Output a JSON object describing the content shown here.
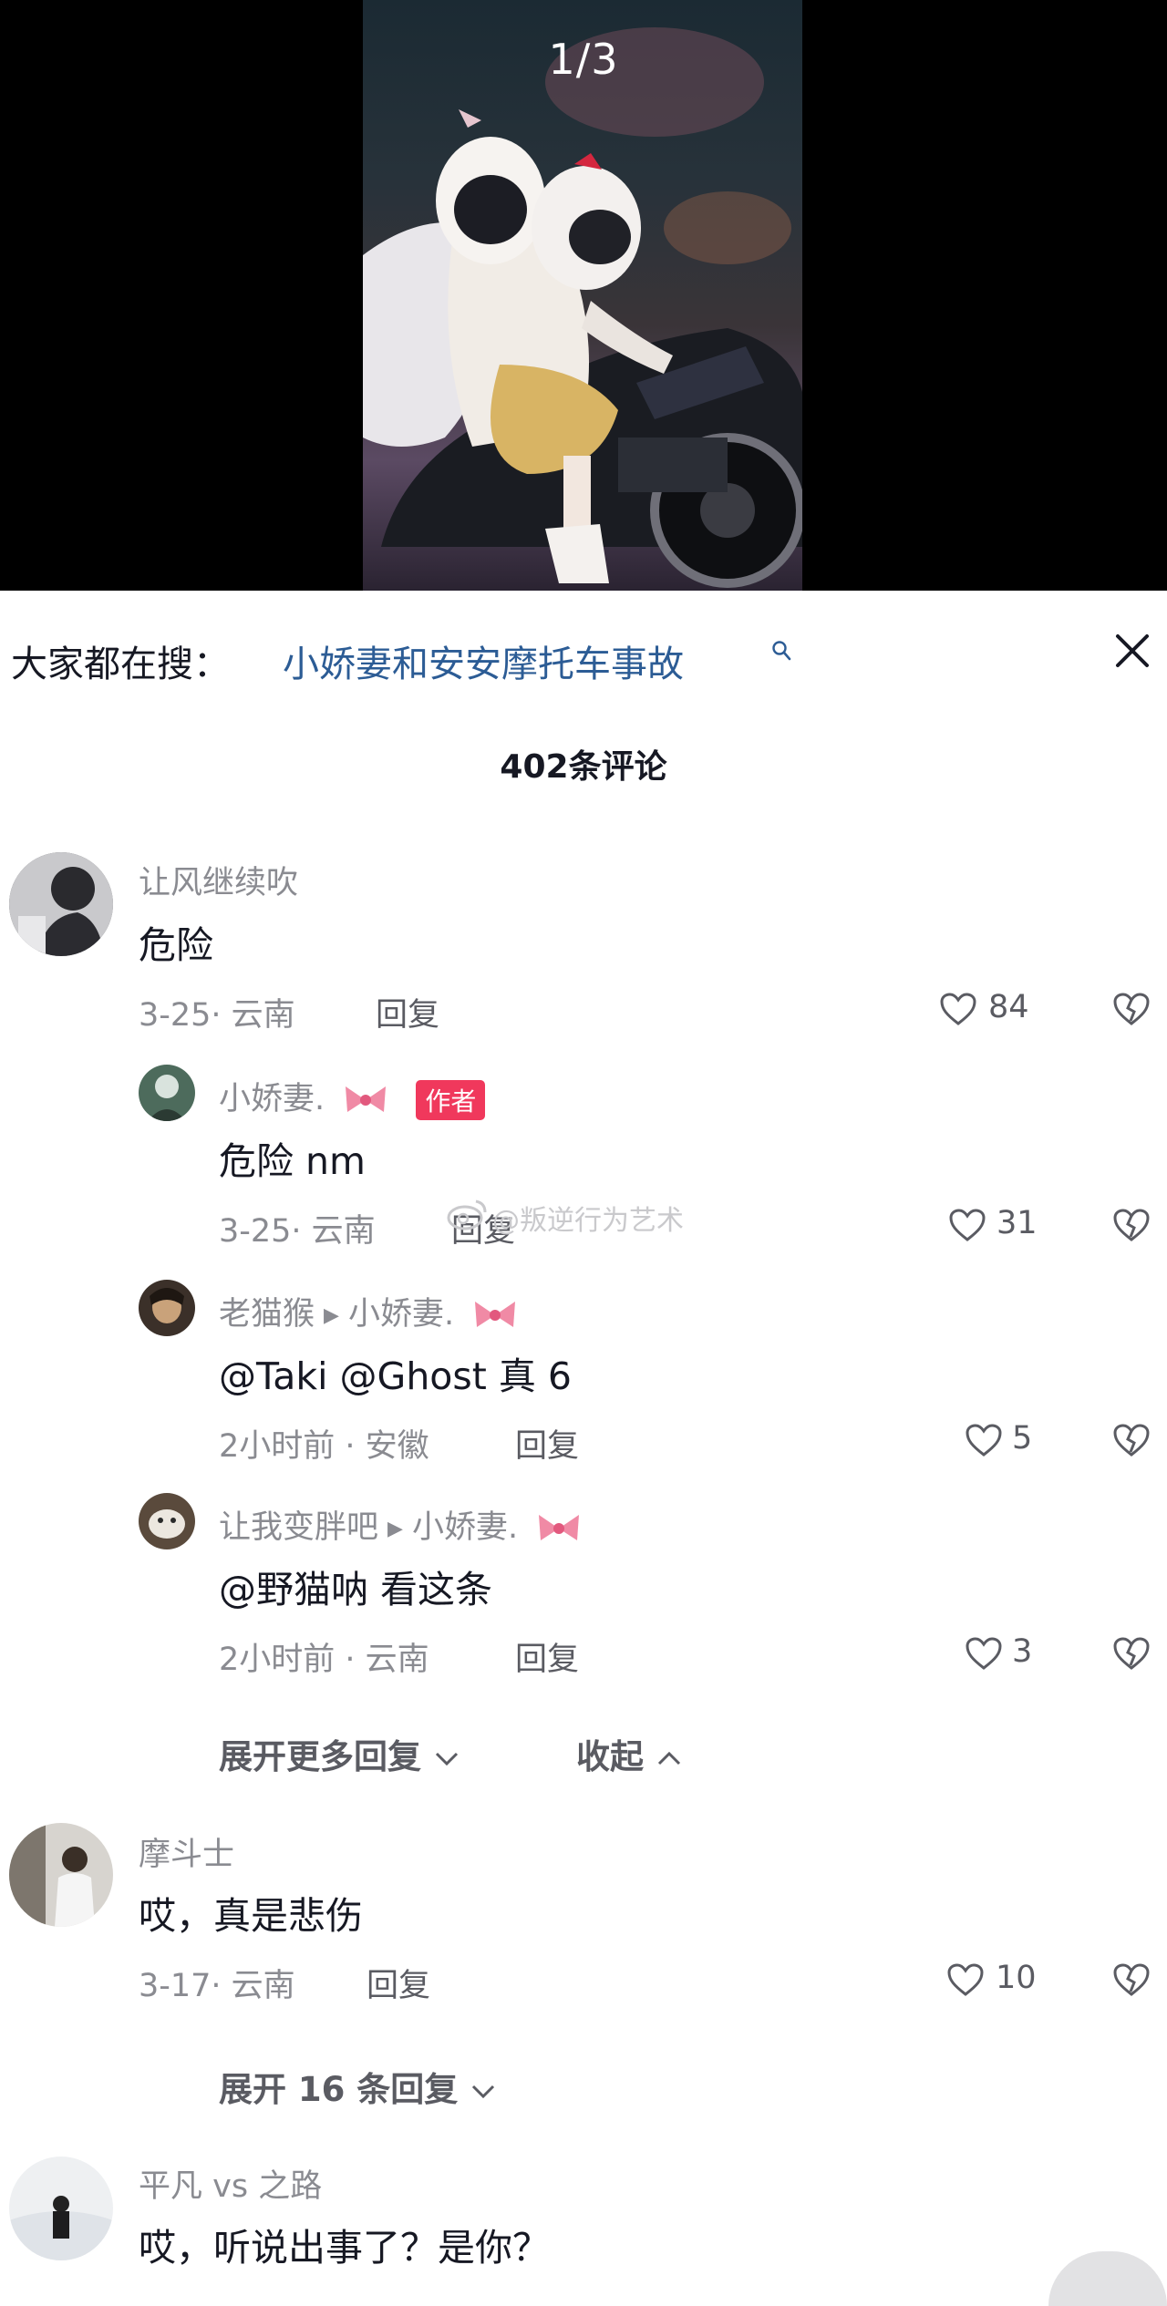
{
  "video": {
    "counter": "1/3"
  },
  "search": {
    "prefix": "大家都在搜：",
    "term": "小娇妻和安安摩托车事故"
  },
  "comments_header": {
    "count": "402条评论"
  },
  "comments": [
    {
      "user": "让风继续吹",
      "text": "危险",
      "date": "3-25· 云南",
      "reply": "回复",
      "likes": "84",
      "replies": [
        {
          "user": "小娇妻.",
          "badge": "作者",
          "text": "危险 nm",
          "date": "3-25· 云南",
          "reply": "回复",
          "likes": "31"
        },
        {
          "user": "老猫猴",
          "to": "小娇妻.",
          "text": "@Taki @Ghost 真 6",
          "date": "2小时前 · 安徽",
          "reply": "回复",
          "likes": "5"
        },
        {
          "user": "让我变胖吧",
          "to": "小娇妻.",
          "text": "@野猫呐 看这条",
          "date": "2小时前 · 云南",
          "reply": "回复",
          "likes": "3"
        }
      ],
      "expand_more": "展开更多回复",
      "collapse": "收起"
    },
    {
      "user": "摩斗士",
      "text": "哎，真是悲伤",
      "date": "3-17· 云南",
      "reply": "回复",
      "likes": "10",
      "expand": "展开 16 条回复"
    },
    {
      "user": "平凡 vs 之路",
      "text": "哎，听说出事了？是你？"
    }
  ],
  "watermark": "@叛逆行为艺术",
  "colors": {
    "accent_link": "#2c5c95",
    "author_badge": "#f0385c",
    "muted": "#8a8b91"
  }
}
